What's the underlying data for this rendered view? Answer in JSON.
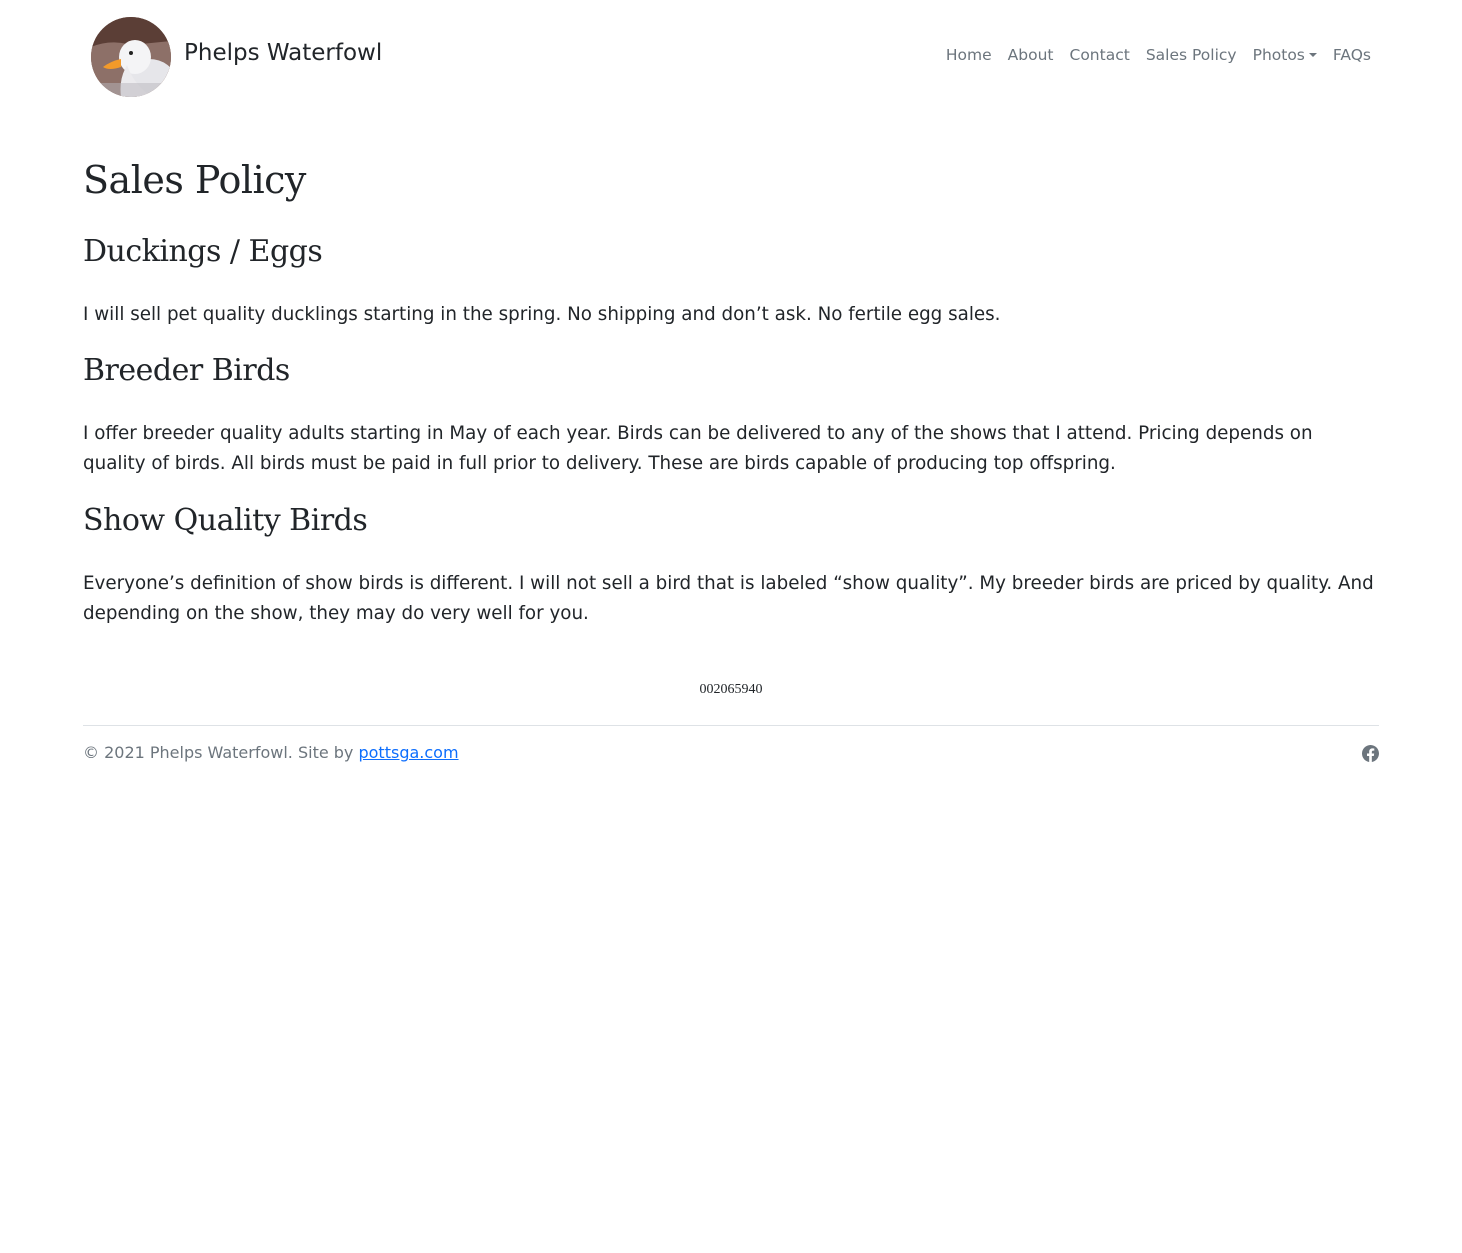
{
  "header": {
    "brand_name": "Phelps Waterfowl",
    "logo_icon": "duck-avatar",
    "nav": [
      {
        "label": "Home"
      },
      {
        "label": "About"
      },
      {
        "label": "Contact"
      },
      {
        "label": "Sales Policy"
      },
      {
        "label": "Photos",
        "has_dropdown": true
      },
      {
        "label": "FAQs"
      }
    ]
  },
  "main": {
    "title": "Sales Policy",
    "sections": [
      {
        "heading": "Duckings / Eggs",
        "text": "I will sell pet quality ducklings starting in the spring. No shipping and don’t ask. No fertile egg sales."
      },
      {
        "heading": "Breeder Birds",
        "text": "I offer breeder quality adults starting in May of each year. Birds can be delivered to any of the shows that I attend. Pricing depends on quality of birds. All birds must be paid in full prior to delivery. These are birds capable of producing top offspring."
      },
      {
        "heading": "Show Quality Birds",
        "text": "Everyone’s definition of show birds is different. I will not sell a bird that is labeled “show quality”. My breeder birds are priced by quality. And depending on the show, they may do very well for you."
      }
    ],
    "counter": "002065940"
  },
  "footer": {
    "copyright": "© 2021 Phelps Waterfowl. Site by ",
    "link_text": "pottsga.com",
    "social_icon": "facebook-icon"
  },
  "colors": {
    "text": "#212529",
    "muted": "#6c757d",
    "link": "#0d6efd",
    "rule": "#dee2e6"
  }
}
